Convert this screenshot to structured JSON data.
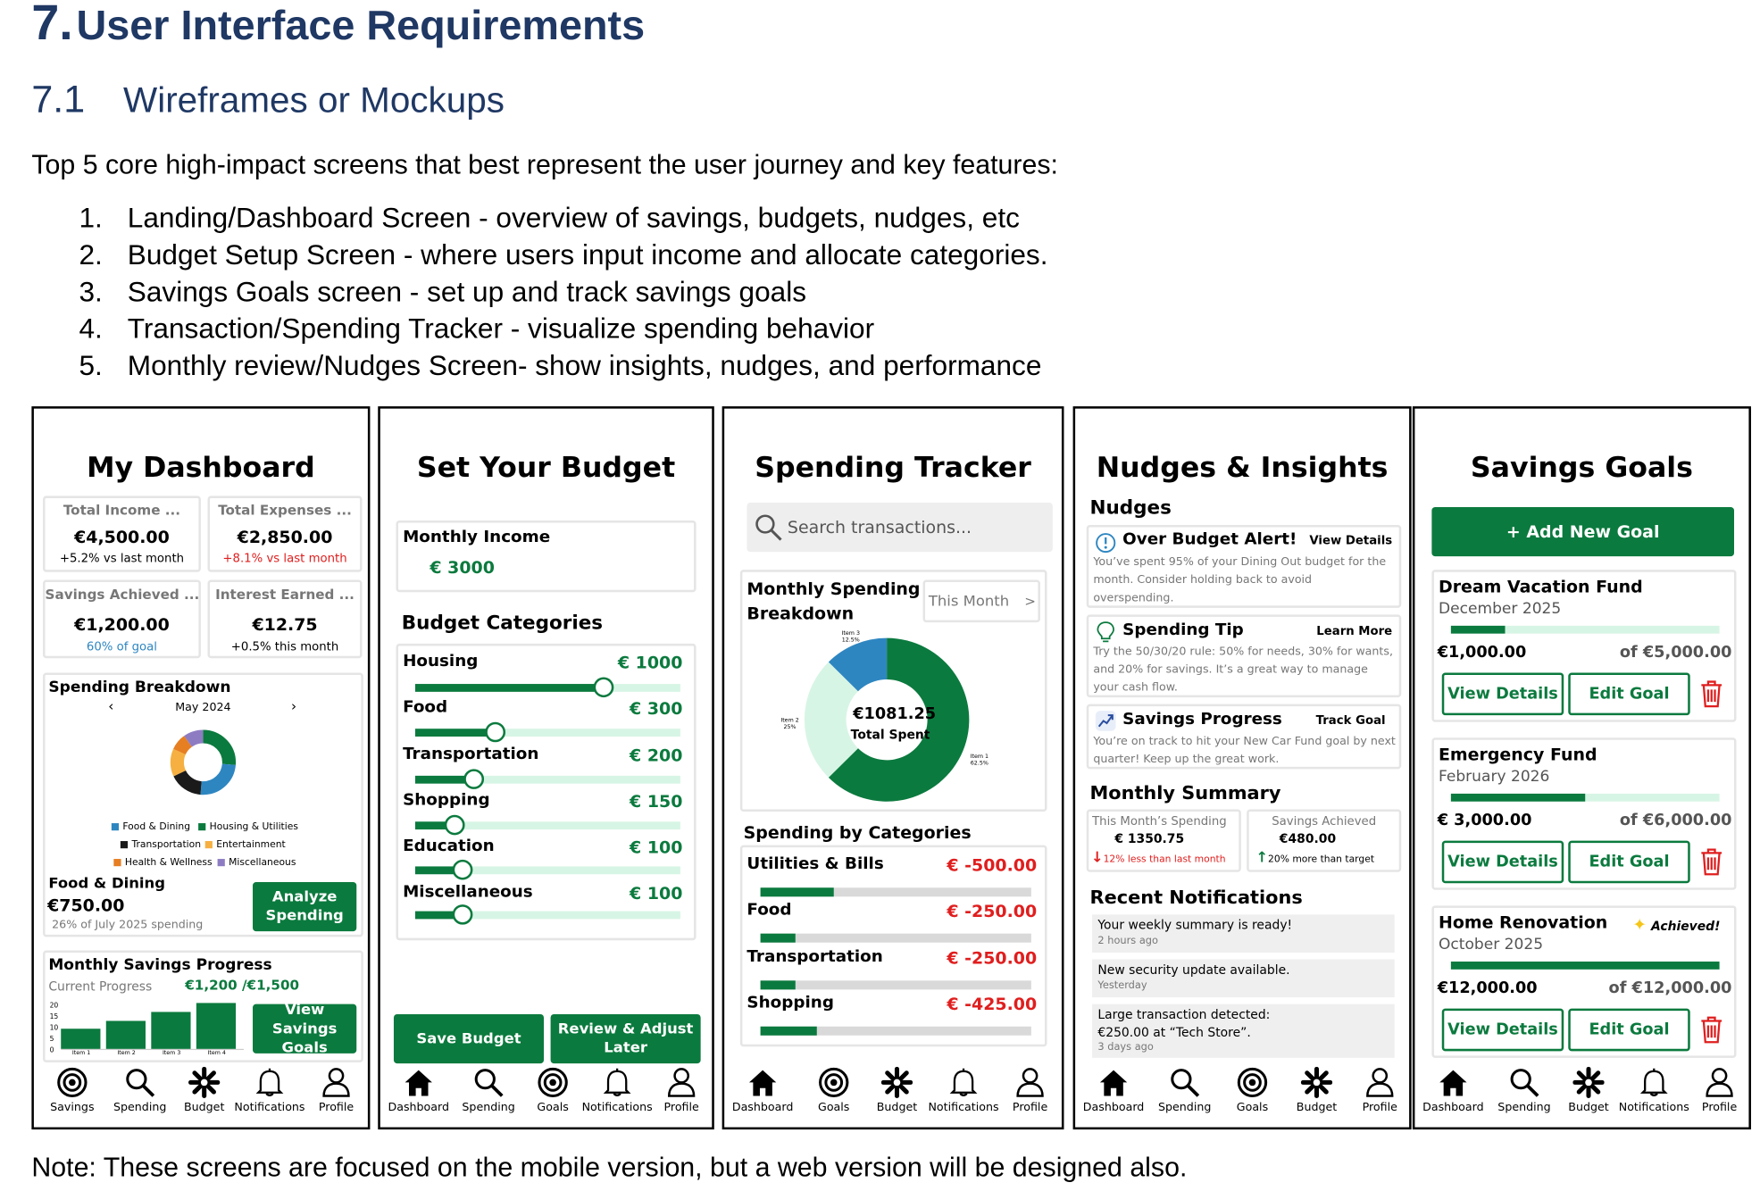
{
  "doc": {
    "section_num": "7.",
    "section_title": "User Interface Requirements",
    "sub_num": "7.1",
    "sub_title": "Wireframes or Mockups",
    "intro": "Top 5 core high-impact screens that best represent the user journey and key features:",
    "items": [
      {
        "n": "1.",
        "text": "Landing/Dashboard Screen - overview of savings, budgets, nudges, etc"
      },
      {
        "n": "2.",
        "text": "Budget Setup Screen - where users input income and allocate categories."
      },
      {
        "n": "3.",
        "text": "Savings Goals screen - set up and track savings goals"
      },
      {
        "n": "4.",
        "text": "Transaction/Spending Tracker - visualize spending behavior"
      },
      {
        "n": "5.",
        "text": "Monthly review/Nudges Screen- show insights, nudges, and performance"
      }
    ],
    "note": "Note: These screens are focused on the mobile version, but a web version will be designed also."
  },
  "colors": {
    "accent": "#0b7a3e",
    "light_green": "#d7f5e5",
    "negative": "#e01e1e",
    "heading": "#1f3864",
    "blue": "#2e86c1"
  },
  "dashboard": {
    "title": "My Dashboard",
    "stats": [
      {
        "label": "Total Income ...",
        "value": "€4,500.00",
        "sub": "+5.2% vs last month"
      },
      {
        "label": "Total Expenses ...",
        "value": "€2,850.00",
        "sub": "+8.1% vs last month"
      },
      {
        "label": "Savings Achieved ...",
        "value": "€1,200.00",
        "sub": "60% of goal"
      },
      {
        "label": "Interest Earned ...",
        "value": "€12.75",
        "sub": "+0.5% this month"
      }
    ],
    "breakdown": {
      "title": "Spending Breakdown",
      "month": "May 2024",
      "prev": "‹",
      "next": "›",
      "legend": [
        "Food & Dining",
        "Housing & Utilities",
        "Transportation",
        "Entertainment",
        "Health & Wellness",
        "Miscellaneous"
      ],
      "legend_colors": [
        "#2e86c1",
        "#0b7a3e",
        "#1a1a1a",
        "#f5b041",
        "#e67e22",
        "#8e7cc3"
      ],
      "category": "Food & Dining",
      "amount": "€750.00",
      "share": "26% of July 2025 spending",
      "button": "Analyze Spending"
    },
    "savings": {
      "title": "Monthly Savings Progress",
      "label": "Current Progress",
      "value": "€1,200 /€1,500",
      "yticks": [
        "20",
        "15",
        "10",
        "5",
        "0"
      ],
      "bars": [
        "Item 1",
        "Item 2",
        "Item 3",
        "Item 4"
      ],
      "button": "View Savings Goals"
    },
    "nav": [
      {
        "label": "Savings",
        "icon": "target-icon"
      },
      {
        "label": "Spending",
        "icon": "search-icon"
      },
      {
        "label": "Budget",
        "icon": "asterisk-icon"
      },
      {
        "label": "Notifications",
        "icon": "bell-icon"
      },
      {
        "label": "Profile",
        "icon": "person-icon"
      }
    ]
  },
  "budget": {
    "title": "Set Your Budget",
    "income_label": "Monthly Income",
    "income_value": "€ 3000",
    "categories_title": "Budget Categories",
    "categories": [
      {
        "name": "Housing",
        "amount": "€ 1000",
        "level": 0.71
      },
      {
        "name": "Food",
        "amount": "€ 300",
        "level": 0.3
      },
      {
        "name": "Transportation",
        "amount": "€ 200",
        "level": 0.22
      },
      {
        "name": "Shopping",
        "amount": "€ 150",
        "level": 0.15
      },
      {
        "name": "Education",
        "amount": "€ 100",
        "level": 0.18
      },
      {
        "name": "Miscellaneous",
        "amount": "€ 100",
        "level": 0.18
      }
    ],
    "save_button": "Save Budget",
    "later_button": "Review & Adjust Later",
    "nav": [
      {
        "label": "Dashboard",
        "icon": "home-icon"
      },
      {
        "label": "Spending",
        "icon": "search-icon"
      },
      {
        "label": "Goals",
        "icon": "target-icon"
      },
      {
        "label": "Notifications",
        "icon": "bell-icon"
      },
      {
        "label": "Profile",
        "icon": "person-icon"
      }
    ]
  },
  "spending": {
    "title": "Spending Tracker",
    "search_placeholder": "Search transactions...",
    "breakdown_title": "Monthly Spending Breakdown",
    "period": "This Month",
    "period_arrow": ">",
    "total": "€1081.25",
    "total_label": "Total Spent",
    "donut": [
      {
        "label": "Item 1",
        "pct": "62.5%",
        "value": 62.5,
        "color": "#0b7a3e"
      },
      {
        "label": "Item 2",
        "pct": "25%",
        "value": 25,
        "color": "#d7f5e5"
      },
      {
        "label": "Item 3",
        "pct": "12.5%",
        "value": 12.5,
        "color": "#2e86c1"
      }
    ],
    "categories_title": "Spending by Categories",
    "categories": [
      {
        "name": "Utilities & Bills",
        "amount": "€ -500.00",
        "level": 0.27
      },
      {
        "name": "Food",
        "amount": "€ -250.00",
        "level": 0.13
      },
      {
        "name": "Transportation",
        "amount": "€ -250.00",
        "level": 0.13
      },
      {
        "name": "Shopping",
        "amount": "€ -425.00",
        "level": 0.21
      }
    ],
    "nav": [
      {
        "label": "Dashboard",
        "icon": "home-icon"
      },
      {
        "label": "Goals",
        "icon": "target-icon"
      },
      {
        "label": "Budget",
        "icon": "asterisk-icon"
      },
      {
        "label": "Notifications",
        "icon": "bell-icon"
      },
      {
        "label": "Profile",
        "icon": "person-icon"
      }
    ]
  },
  "nudges": {
    "title": "Nudges & Insights",
    "nudges_title": "Nudges",
    "cards": [
      {
        "title": "Over Budget Alert!",
        "action": "View Details",
        "body": "You’ve spent 95% of your Dining Out budget for the month. Consider holding back to avoid overspending.",
        "icon": "alert-icon"
      },
      {
        "title": "Spending Tip",
        "action": "Learn More",
        "body": "Try the 50/30/20 rule: 50% for needs, 30% for wants, and 20% for savings. It’s a great way to manage your cash flow.",
        "icon": "lightbulb-icon"
      },
      {
        "title": "Savings Progress",
        "action": "Track Goal",
        "body": "You’re on track to hit your New Car Fund goal by next quarter! Keep up the great work.",
        "icon": "trend-icon"
      }
    ],
    "summary_title": "Monthly Summary",
    "summary": [
      {
        "label": "This Month’s Spending",
        "value": "€ 1350.75",
        "delta": "12% less than last month"
      },
      {
        "label": "Savings Achieved",
        "value": "€480.00",
        "delta": "20% more than target"
      }
    ],
    "notifications_title": "Recent Notifications",
    "notifications": [
      {
        "text": "Your weekly summary is ready!",
        "time": "2 hours ago"
      },
      {
        "text": "New security update available.",
        "time": "Yesterday"
      },
      {
        "text": "Large transaction detected: €250.00 at “Tech Store”.",
        "time": "3 days ago"
      }
    ],
    "nav": [
      {
        "label": "Dashboard",
        "icon": "home-icon"
      },
      {
        "label": "Spending",
        "icon": "search-icon"
      },
      {
        "label": "Goals",
        "icon": "target-icon"
      },
      {
        "label": "Budget",
        "icon": "asterisk-icon"
      },
      {
        "label": "Profile",
        "icon": "person-icon"
      }
    ]
  },
  "goals": {
    "title": "Savings Goals",
    "add_button": "+   Add New Goal",
    "goals": [
      {
        "name": "Dream Vacation Fund",
        "date": "December 2025",
        "saved": "€1,000.00",
        "target": "of €5,000.00",
        "progress": 0.2,
        "badge": ""
      },
      {
        "name": "Emergency Fund",
        "date": "February 2026",
        "saved": "€ 3,000.00",
        "target": "of €6,000.00",
        "progress": 0.5,
        "badge": ""
      },
      {
        "name": "Home Renovation",
        "date": "October 2025",
        "saved": "€12,000.00",
        "target": "of €12,000.00",
        "progress": 1.0,
        "badge": "Achieved!"
      }
    ],
    "view_label": "View Details",
    "edit_label": "Edit Goal",
    "nav": [
      {
        "label": "Dashboard",
        "icon": "home-icon"
      },
      {
        "label": "Spending",
        "icon": "search-icon"
      },
      {
        "label": "Budget",
        "icon": "asterisk-icon"
      },
      {
        "label": "Notifications",
        "icon": "bell-icon"
      },
      {
        "label": "Profile",
        "icon": "person-icon"
      }
    ]
  }
}
